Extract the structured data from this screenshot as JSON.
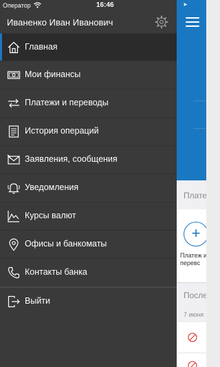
{
  "statusbar": {
    "carrier": "Оператор",
    "wifi_icon": "wifi-icon",
    "time": "16:46"
  },
  "header": {
    "user_name": "Иваненко Иван Иванович",
    "settings_icon": "gear-icon"
  },
  "menu": {
    "items": [
      {
        "label": "Главная",
        "icon": "home-icon",
        "active": true
      },
      {
        "label": "Мои финансы",
        "icon": "money-icon"
      },
      {
        "label": "Платежи и переводы",
        "icon": "transfer-icon"
      },
      {
        "label": "История операций",
        "icon": "history-icon"
      },
      {
        "label": "Заявления, сообщения",
        "icon": "envelope-icon"
      },
      {
        "label": "Уведомления",
        "icon": "bell-icon"
      },
      {
        "label": "Курсы валют",
        "icon": "chart-icon"
      },
      {
        "label": "Офисы и банкоматы",
        "icon": "map-pin-icon"
      },
      {
        "label": "Контакты банка",
        "icon": "phone-icon"
      }
    ],
    "logout": {
      "label": "Выйти",
      "icon": "logout-icon"
    }
  },
  "main": {
    "menu_icon": "hamburger-icon",
    "section_payments": "Плате",
    "add_payment_icon": "plus-icon",
    "add_payment_line1": "Платеж и",
    "add_payment_line2": "перевс",
    "section_recent": "После",
    "date": "7 июня",
    "row_icon": "blocked-icon",
    "accent_color": "#1a78c2"
  }
}
